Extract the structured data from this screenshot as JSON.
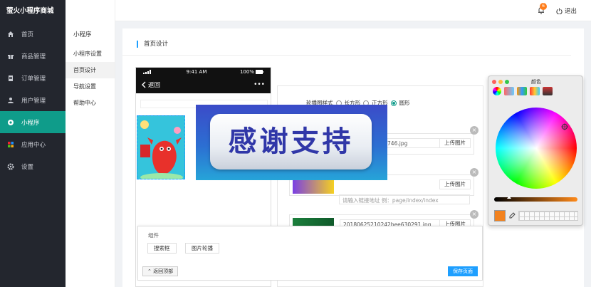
{
  "app": {
    "brand": "萤火小程序商城"
  },
  "nav": {
    "items": [
      {
        "label": "首页",
        "icon": "home-icon"
      },
      {
        "label": "商品管理",
        "icon": "gift-icon"
      },
      {
        "label": "订单管理",
        "icon": "order-icon"
      },
      {
        "label": "用户管理",
        "icon": "user-icon"
      },
      {
        "label": "小程序",
        "icon": "miniapp-icon",
        "active": true
      },
      {
        "label": "应用中心",
        "icon": "apps-icon"
      },
      {
        "label": "设置",
        "icon": "gear-icon"
      }
    ]
  },
  "submenu": {
    "title": "小程序",
    "items": [
      {
        "label": "小程序设置"
      },
      {
        "label": "首页设计",
        "active": true
      },
      {
        "label": "导航设置"
      },
      {
        "label": "帮助中心"
      }
    ]
  },
  "topbar": {
    "notification_count": "6",
    "logout_label": "退出"
  },
  "page": {
    "title": "首页设计"
  },
  "phone": {
    "time": "9:41 AM",
    "battery": "100%",
    "back_label": "返回",
    "more": "•••"
  },
  "editor": {
    "style_label": "轮播图样式",
    "radios": [
      "长方形",
      "正方形",
      "圆形"
    ],
    "rows": [
      {
        "filename": "2018062518524746.jpg",
        "upload": "上传图片"
      },
      {
        "filename": "",
        "upload": "上传图片",
        "link_placeholder": "请输入链接地址   例：page/index/index"
      },
      {
        "filename": "20180625210242bee630291.jpg",
        "upload": "上传图片"
      }
    ]
  },
  "overlay": {
    "text": "感谢支持"
  },
  "components": {
    "label": "组件",
    "buttons": [
      "搜索框",
      "图片轮播"
    ],
    "back_top": "返回顶部",
    "save": "保存页面"
  },
  "color_panel": {
    "title": "颜色",
    "selected": "#f2821e"
  }
}
